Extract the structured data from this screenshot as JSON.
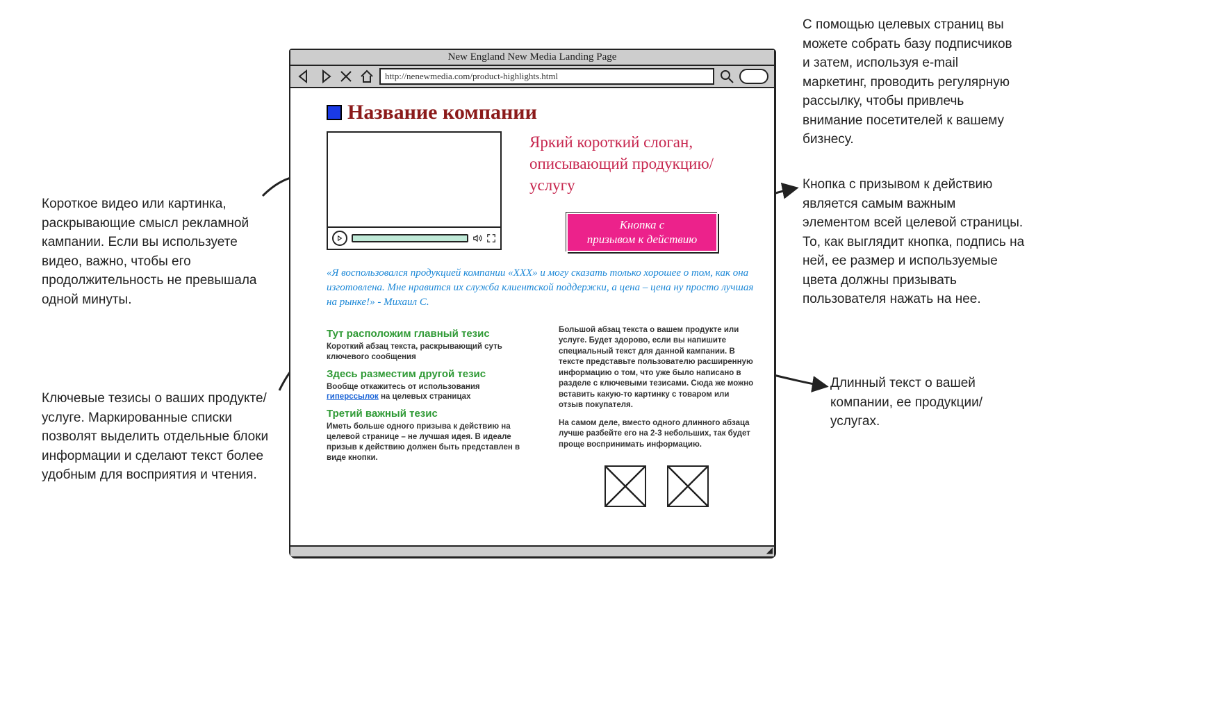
{
  "annotations": {
    "topRight": "С помощью целевых страниц вы можете собрать базу подписчиков и затем, используя e-mail маркетинг, проводить регулярную рассылку, чтобы привлечь внимание посетителей к вашему бизнесу.",
    "video": "Короткое видео или картинка, раскрывающие смысл рекламной кампании. Если вы используете видео, важно, чтобы его продолжительность не превышала одной минуты.",
    "cta": "Кнопка с призывом к действию является самым важным элементом всей целевой страницы. То, как выглядит кнопка, подпись на ней, ее размер и используемые цвета должны призывать пользователя нажать на нее.",
    "keypoints": "Ключевые тезисы о ваших продукте/услуге. Маркированные списки позволят выделить отдельные блоки информации и сделают текст более удобным для восприятия и чтения.",
    "longtext": "Длинный текст о вашей компании, ее продукции/услугах."
  },
  "browser": {
    "title": "New England New Media Landing Page",
    "url": "http://nenewmedia.com/product-highlights.html"
  },
  "page": {
    "companyName": "Название компании",
    "slogan": "Яркий короткий слоган, описывающий продукцию/услугу",
    "ctaLabel": "Кнопка с\nпризывом к действию",
    "quote": "«Я воспользовался продукцией компании «XXX» и могу сказать только хорошее о том, как она изготовлена. Мне нравится их служба клиентской поддержки, а цена – цена ну просто лучшая на рынке!» - Михаил С.",
    "keyPoints": [
      {
        "title": "Тут расположим главный тезис",
        "text": "Короткий абзац текста, раскрывающий суть ключевого сообщения"
      },
      {
        "title": "Здесь разместим другой тезис",
        "text_pre": "Вообще откажитесь от использования ",
        "link": "гиперссылок",
        "text_post": " на целевых страницах"
      },
      {
        "title": "Третий важный тезис",
        "text": "Иметь больше одного призыва к действию на целевой странице – не лучшая идея. В идеале призыв к действию должен быть представлен в виде кнопки."
      }
    ],
    "longText1": "Большой абзац текста о вашем продукте или услуге. Будет здорово, если вы напишите специальный текст для данной кампании. В тексте представьте пользователю расширенную информацию о том, что уже было написано в разделе с ключевыми тезисами. Сюда же можно вставить какую-то картинку с товаром или отзыв покупателя.",
    "longText2": "На самом деле, вместо одного длинного абзаца лучше разбейте его на 2-3 небольших, так будет проще воспринимать информацию."
  }
}
